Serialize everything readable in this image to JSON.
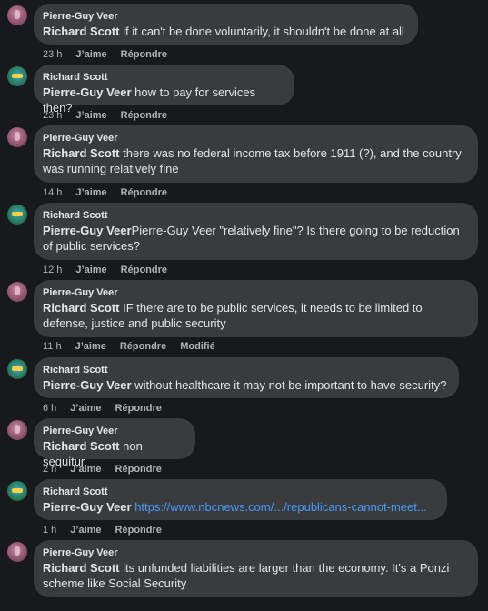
{
  "comments": [
    {
      "author": "Pierre-Guy Veer",
      "mention": "Richard Scott",
      "text": " if it can't be done voluntarily, it shouldn't be done at all",
      "time": "23 h",
      "like": "J’aime",
      "reply": "Répondre"
    },
    {
      "author": "Richard Scott",
      "mention": "Pierre-Guy Veer",
      "text": " how to pay for services then?",
      "time": "23 h",
      "like": "J’aime",
      "reply": "Répondre"
    },
    {
      "author": "Pierre-Guy Veer",
      "mention": "Richard Scott",
      "text": " there was no federal income tax before 1911 (?), and the country was running relatively fine",
      "time": "14 h",
      "like": "J’aime",
      "reply": "Répondre"
    },
    {
      "author": "Richard Scott",
      "mention": "Pierre-Guy Veer",
      "text": "Pierre-Guy Veer \"relatively fine\"? Is there going to be reduction of public services?",
      "time": "12 h",
      "like": "J’aime",
      "reply": "Répondre"
    },
    {
      "author": "Pierre-Guy Veer",
      "mention": "Richard Scott",
      "text": " IF there are to be public services, it needs to be limited to defense, justice and public security",
      "time": "11 h",
      "like": "J’aime",
      "reply": "Répondre",
      "edited": "Modifié"
    },
    {
      "author": "Richard Scott",
      "mention": "Pierre-Guy Veer",
      "text": " without healthcare it may not be important to have security?",
      "time": "6 h",
      "like": "J’aime",
      "reply": "Répondre"
    },
    {
      "author": "Pierre-Guy Veer",
      "mention": "Richard Scott",
      "text": " non sequitur",
      "time": "2 h",
      "like": "J’aime",
      "reply": "Répondre"
    },
    {
      "author": "Richard Scott",
      "mention": "Pierre-Guy Veer",
      "text": " ",
      "link": "https://www.nbcnews.com/.../republicans-cannot-meet...",
      "time": "1 h",
      "like": "J’aime",
      "reply": "Répondre"
    },
    {
      "author": "Pierre-Guy Veer",
      "mention": "Richard Scott",
      "text": " its unfunded liabilities are larger than the economy. It's a Ponzi scheme like Social Security",
      "time": "",
      "like": "",
      "reply": ""
    }
  ]
}
